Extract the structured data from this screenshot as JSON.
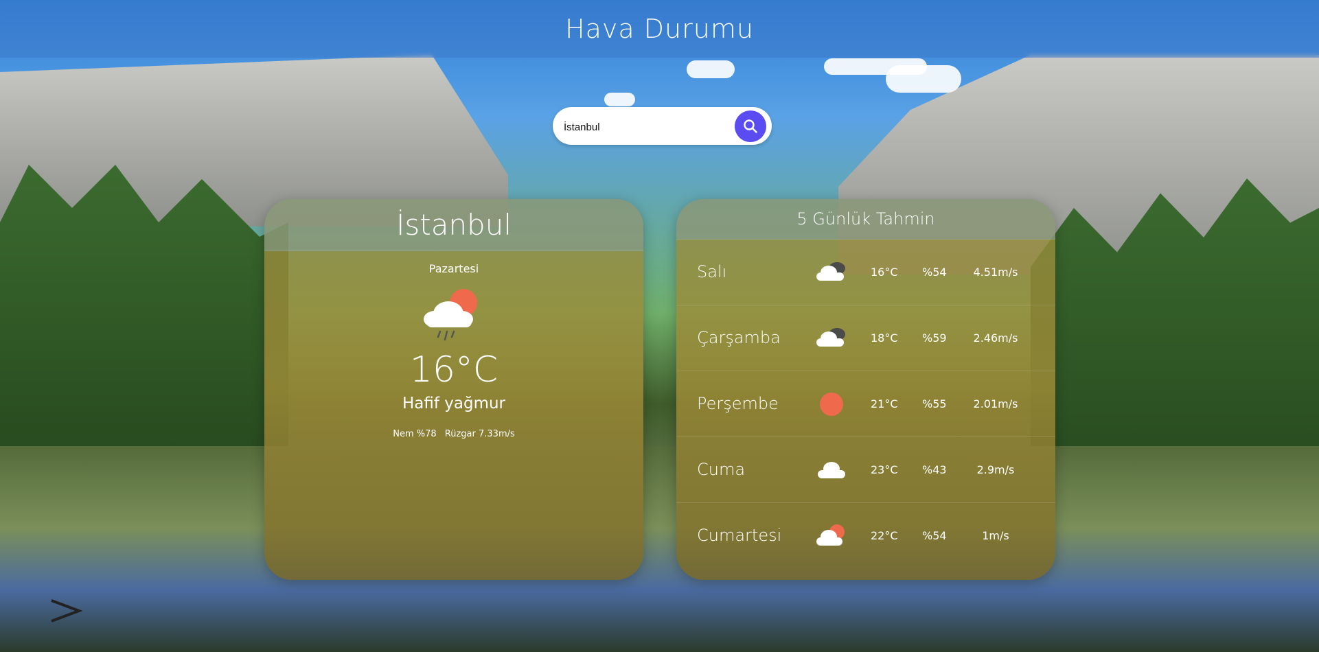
{
  "header": {
    "title": "Hava Durumu"
  },
  "search": {
    "value": "İstanbul",
    "icon": "search-icon",
    "button_color": "#5a4cf0"
  },
  "current": {
    "city": "İstanbul",
    "day": "Pazartesi",
    "icon": "cloud-rain-sun-icon",
    "temperature": "16°C",
    "description": "Hafif yağmur",
    "humidity": "Nem %78",
    "wind": "Rüzgar 7.33m/s"
  },
  "forecast": {
    "title": "5 Günlük Tahmin",
    "days": [
      {
        "day": "Salı",
        "icon": "cloudy-dark-icon",
        "temp": "16°C",
        "humidity": "%54",
        "wind": "4.51m/s"
      },
      {
        "day": "Çarşamba",
        "icon": "cloudy-dark-icon",
        "temp": "18°C",
        "humidity": "%59",
        "wind": "2.46m/s"
      },
      {
        "day": "Perşembe",
        "icon": "sun-icon",
        "temp": "21°C",
        "humidity": "%55",
        "wind": "2.01m/s"
      },
      {
        "day": "Cuma",
        "icon": "cloud-icon",
        "temp": "23°C",
        "humidity": "%43",
        "wind": "2.9m/s"
      },
      {
        "day": "Cumartesi",
        "icon": "sun-cloud-icon",
        "temp": "22°C",
        "humidity": "%54",
        "wind": "1m/s"
      }
    ]
  },
  "colors": {
    "sun": "#ef6a4c",
    "cloud": "#ffffff",
    "dark_cloud": "#4a4a4a"
  }
}
